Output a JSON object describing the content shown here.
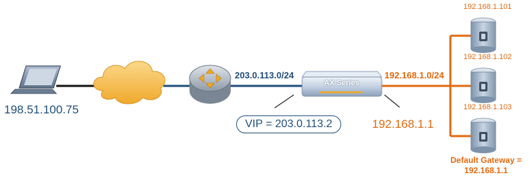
{
  "diagram": {
    "client_ip": "198.51.100.75",
    "public_subnet": "203.0.113.0/24",
    "device_label": "AX Series",
    "vip_label": "VIP = 203.0.113.2",
    "inside_ip": "192.168.1.1",
    "private_subnet": "192.168.1.0/24",
    "servers": [
      {
        "ip": "192.168.1.101"
      },
      {
        "ip": "192.168.1.102"
      },
      {
        "ip": "192.168.1.103"
      }
    ],
    "gateway_line1": "Default Gateway =",
    "gateway_line2": "192.168.1.1"
  },
  "colors": {
    "outside_link": "#1f4e79",
    "inside_link": "#e06a10",
    "client_link": "#111111",
    "cloud": "#f5b942",
    "device_body": "#c9d6e6",
    "server_body": "#9fb3c8"
  },
  "icons": {
    "client": "laptop-icon",
    "internet": "cloud-icon",
    "router": "router-icon",
    "load_balancer": "ax-series-device-icon",
    "server": "server-icon"
  }
}
